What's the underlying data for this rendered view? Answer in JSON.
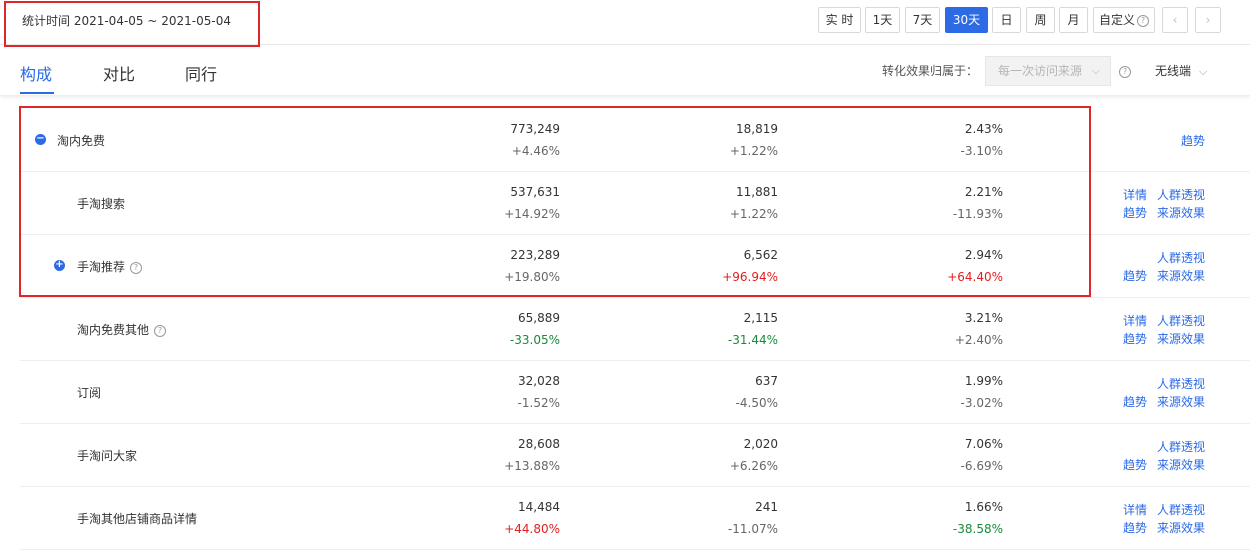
{
  "header": {
    "stat_time": "统计时间 2021-04-05 ~ 2021-05-04",
    "ranges": [
      "实 时",
      "1天",
      "7天",
      "30天",
      "日",
      "周",
      "月"
    ],
    "custom_label": "自定义",
    "prev_icon": "chevron-left-icon",
    "next_icon": "chevron-right-icon"
  },
  "tabs": {
    "items": [
      "构成",
      "对比",
      "同行"
    ],
    "active": "构成"
  },
  "filters": {
    "attribution_label": "转化效果归属于：",
    "attribution_value": "每一次访问来源",
    "device": "无线端"
  },
  "colors": {
    "accent": "#2c6ae6",
    "up": "#e02020",
    "down": "#1a8a3a",
    "highlight": "#e0262a"
  },
  "rows": [
    {
      "name": "淘内免费",
      "toggle": "−",
      "help": false,
      "visitors": "773,249",
      "visitors_change": "+4.46%",
      "buyers": "18,819",
      "buyers_change": "+1.22%",
      "rate": "2.43%",
      "rate_change": "-3.10%",
      "links": {
        "trend": "趋势"
      }
    },
    {
      "name": "手淘搜索",
      "help": false,
      "visitors": "537,631",
      "visitors_change": "+14.92%",
      "buyers": "11,881",
      "buyers_change": "+1.22%",
      "rate": "2.21%",
      "rate_change": "-11.93%",
      "links": {
        "detail": "详情",
        "crowd": "人群透视",
        "trend": "趋势",
        "effect": "来源效果"
      }
    },
    {
      "name": "手淘推荐",
      "toggle": "+",
      "help": true,
      "visitors": "223,289",
      "visitors_change": "+19.80%",
      "buyers": "6,562",
      "buyers_change": "+96.94%",
      "buyers_change_color": "up",
      "rate": "2.94%",
      "rate_change": "+64.40%",
      "rate_change_color": "up",
      "links": {
        "crowd": "人群透视",
        "trend": "趋势",
        "effect": "来源效果"
      }
    },
    {
      "name": "淘内免费其他",
      "help": true,
      "visitors": "65,889",
      "visitors_change": "-33.05%",
      "visitors_change_color": "down",
      "buyers": "2,115",
      "buyers_change": "-31.44%",
      "buyers_change_color": "down",
      "rate": "3.21%",
      "rate_change": "+2.40%",
      "links": {
        "detail": "详情",
        "crowd": "人群透视",
        "trend": "趋势",
        "effect": "来源效果"
      }
    },
    {
      "name": "订阅",
      "help": false,
      "visitors": "32,028",
      "visitors_change": "-1.52%",
      "buyers": "637",
      "buyers_change": "-4.50%",
      "rate": "1.99%",
      "rate_change": "-3.02%",
      "links": {
        "crowd": "人群透视",
        "trend": "趋势",
        "effect": "来源效果"
      }
    },
    {
      "name": "手淘问大家",
      "help": false,
      "visitors": "28,608",
      "visitors_change": "+13.88%",
      "buyers": "2,020",
      "buyers_change": "+6.26%",
      "rate": "7.06%",
      "rate_change": "-6.69%",
      "links": {
        "crowd": "人群透视",
        "trend": "趋势",
        "effect": "来源效果"
      }
    },
    {
      "name": "手淘其他店铺商品详情",
      "help": false,
      "visitors": "14,484",
      "visitors_change": "+44.80%",
      "visitors_change_color": "up",
      "buyers": "241",
      "buyers_change": "-11.07%",
      "rate": "1.66%",
      "rate_change": "-38.58%",
      "rate_change_color": "down",
      "links": {
        "detail": "详情",
        "crowd": "人群透视",
        "trend": "趋势",
        "effect": "来源效果"
      }
    }
  ]
}
